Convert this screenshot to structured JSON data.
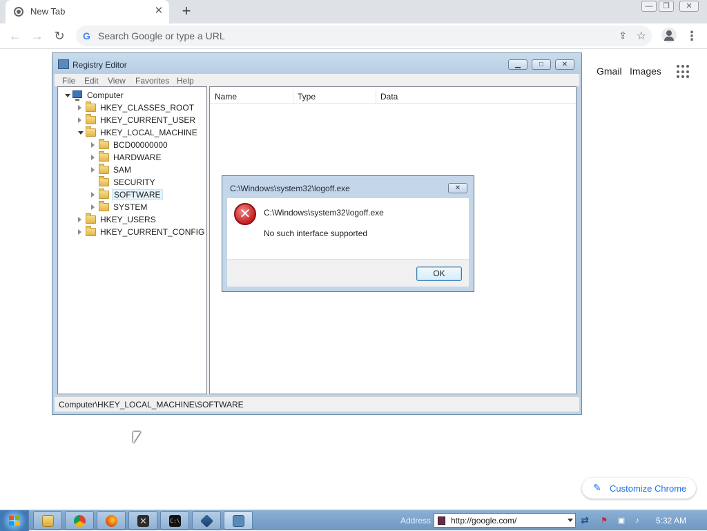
{
  "browser": {
    "tab_title": "New Tab",
    "tab_close_glyph": "✕",
    "new_tab_glyph": "+",
    "omnibox_placeholder": "Search Google or type a URL",
    "google_links": [
      "Gmail",
      "Images"
    ],
    "customize_label": "Customize Chrome",
    "icons": [
      "chrome-favicon",
      "back-arrow-icon",
      "forward-arrow-icon",
      "reload-icon",
      "google-g-icon",
      "share-icon",
      "star-icon",
      "profile-icon",
      "menu-kebab-icon",
      "apps-grid-icon",
      "pencil-icon"
    ]
  },
  "regedit": {
    "title": "Registry Editor",
    "menu": [
      "File",
      "Edit",
      "View",
      "Favorites",
      "Help"
    ],
    "tree": {
      "root": "Computer",
      "hives": [
        {
          "label": "HKEY_CLASSES_ROOT",
          "expanded": false
        },
        {
          "label": "HKEY_CURRENT_USER",
          "expanded": false
        },
        {
          "label": "HKEY_LOCAL_MACHINE",
          "expanded": true
        },
        {
          "label": "HKEY_USERS",
          "expanded": false
        },
        {
          "label": "HKEY_CURRENT_CONFIG",
          "expanded": false
        }
      ],
      "hklm_children": [
        {
          "label": "BCD00000000",
          "has_children": true
        },
        {
          "label": "HARDWARE",
          "has_children": true
        },
        {
          "label": "SAM",
          "has_children": true
        },
        {
          "label": "SECURITY",
          "has_children": false
        },
        {
          "label": "SOFTWARE",
          "has_children": true,
          "selected": true
        },
        {
          "label": "SYSTEM",
          "has_children": true
        }
      ]
    },
    "columns": [
      "Name",
      "Type",
      "Data"
    ],
    "status_path": "Computer\\HKEY_LOCAL_MACHINE\\SOFTWARE"
  },
  "dialog": {
    "title": "C:\\Windows\\system32\\logoff.exe",
    "message_line1": "C:\\Windows\\system32\\logoff.exe",
    "message_line2": "No such interface supported",
    "ok_label": "OK",
    "icon": "error-icon"
  },
  "taskbar": {
    "address_label": "Address",
    "address_url": "http://google.com/",
    "clock": "5:32 AM",
    "pinned": [
      "explorer",
      "chrome",
      "firefox",
      "terminal-x",
      "cmd",
      "virtualbox",
      "registry-editor"
    ],
    "tray_icons": [
      "go-arrows-icon",
      "network-x-icon",
      "monitor-icon",
      "volume-icon"
    ]
  },
  "colors": {
    "chrome_tabstrip": "#dee1e6",
    "regedit_frame": "#bfd4e8",
    "dialog_frame": "#c4d6e9",
    "error_red": "#c72020",
    "taskbar": "#7ea4cc",
    "link_blue": "#1a73e8"
  }
}
